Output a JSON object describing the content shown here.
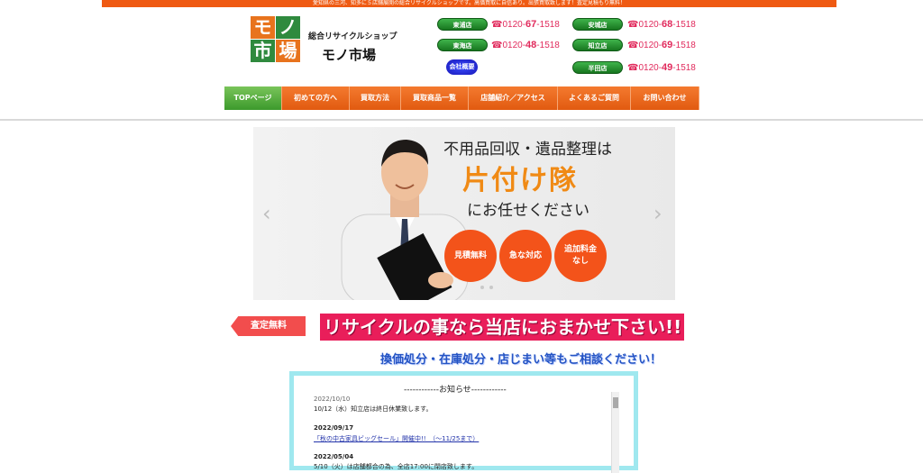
{
  "top_banner": "愛知県の三河、知多に５店舗展開の総合リサイクルショップです。高価買取に自信あり。出張買取致します！査定見積もり無料！",
  "logo": {
    "chars": [
      "モ",
      "ノ",
      "市",
      "場"
    ],
    "colors": [
      "#e8731d",
      "#2f8a3e",
      "#2f8a3e",
      "#e8731d"
    ]
  },
  "brand": {
    "small": "総合リサイクルショップ",
    "big": "モノ市場"
  },
  "stores": [
    {
      "name": "東浦店",
      "phone_prefix": "☎0120-",
      "phone_mid": "67",
      "phone_end": "-1518"
    },
    {
      "name": "東海店",
      "phone_prefix": "☎0120-",
      "phone_mid": "48",
      "phone_end": "-1518"
    },
    {
      "name": "安城店",
      "phone_prefix": "☎0120-",
      "phone_mid": "68",
      "phone_end": "-1518"
    },
    {
      "name": "知立店",
      "phone_prefix": "☎0120-",
      "phone_mid": "69",
      "phone_end": "-1518"
    },
    {
      "name": "半田店",
      "phone_prefix": "☎0120-",
      "phone_mid": "49",
      "phone_end": "-1518"
    }
  ],
  "corp_button": "会社概要",
  "nav": [
    {
      "label": "TOPページ",
      "active": true
    },
    {
      "label": "初めての方へ"
    },
    {
      "label": "買取方法"
    },
    {
      "label": "買取商品一覧"
    },
    {
      "label": "店舗紹介／アクセス"
    },
    {
      "label": "よくあるご質問"
    },
    {
      "label": "お問い合わせ"
    }
  ],
  "slider": {
    "line1": "不用品回収・遺品整理は",
    "line2": "片付け隊",
    "line3": "にお任せください",
    "circles": [
      "見積無料",
      "急な対応",
      "追加料金\nなし"
    ],
    "prev": "‹",
    "next": "›"
  },
  "badge": "査定無料",
  "headline": "リサイクルの事なら当店におまかせ下さい!!",
  "subline": "換価処分・在庫処分・店じまい等もご相談ください！",
  "news": {
    "title": "------------お知らせ------------",
    "items": [
      {
        "date": "2022/10/10",
        "text": "10/12（水）知立店は終日休業致します。"
      },
      {
        "date": "2022/09/17",
        "link": "「秋の中古家具ビッグセール」開催中!!　（～11/25まで）"
      },
      {
        "date": "2022/05/04",
        "text": "5/10（火）は店舗都合の為、全店17:00に閉店致します。"
      }
    ]
  },
  "colors": {
    "accent": "#ef5a12",
    "nav_active": "#3c9a2c",
    "headline_bg": "#e91e5a",
    "frame": "#9fe8ef"
  }
}
